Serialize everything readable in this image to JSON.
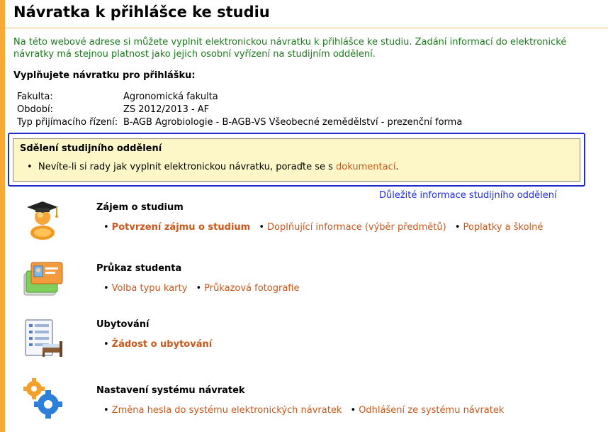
{
  "page": {
    "title": "Návratka k přihlášce ke studiu",
    "intro": "Na této webové adrese si můžete vyplnit elektronickou návratku k přihlášce ke studiu. Zadání informací do elektronické návratky má stejnou platnost jako jejich osobní vyřízení na studijním oddělení.",
    "subhead": "Vyplňujete návratku pro přihlášku:"
  },
  "info": {
    "faculty_label": "Fakulta:",
    "faculty_value": "Agronomická fakulta",
    "period_label": "Období:",
    "period_value": "ZS 2012/2013 - AF",
    "type_label": "Typ přijímacího řízení:",
    "type_value": "B-AGB Agrobiologie - B-AGB-VS Všeobecné zemědělství - prezenční forma"
  },
  "notice": {
    "title": "Sdělení studijního oddělení",
    "text": "Nevíte-li si rady jak vyplnit elektronickou návratku, poraďte se s",
    "link": "dokumentací",
    "tail": "."
  },
  "important_link": "Důležité informace studijního oddělení",
  "sections": {
    "interest": {
      "title": "Zájem o studium",
      "links": [
        "Potvrzení zájmu o studium",
        "Doplňující informace (výběr předmětů)",
        "Poplatky a školné"
      ]
    },
    "card": {
      "title": "Průkaz studenta",
      "links": [
        "Volba typu karty",
        "Průkazová fotografie"
      ]
    },
    "housing": {
      "title": "Ubytování",
      "links": [
        "Žádost o ubytování"
      ]
    },
    "settings": {
      "title": "Nastavení systému návratek",
      "links": [
        "Změna hesla do systému elektronických návratek",
        "Odhlášení ze systému návratek"
      ]
    }
  },
  "bullet": "•",
  "icons": {
    "interest": "graduate-icon",
    "card": "student-card-icon",
    "housing": "bed-list-icon",
    "settings": "gears-icon"
  },
  "colors": {
    "accent_bar": "#f7a835",
    "intro_text": "#1a7a1a",
    "link": "#c8581b",
    "notice_border": "#1f2bd1",
    "notice_bg": "#fdf7c7",
    "important_link": "#1d2de3"
  }
}
